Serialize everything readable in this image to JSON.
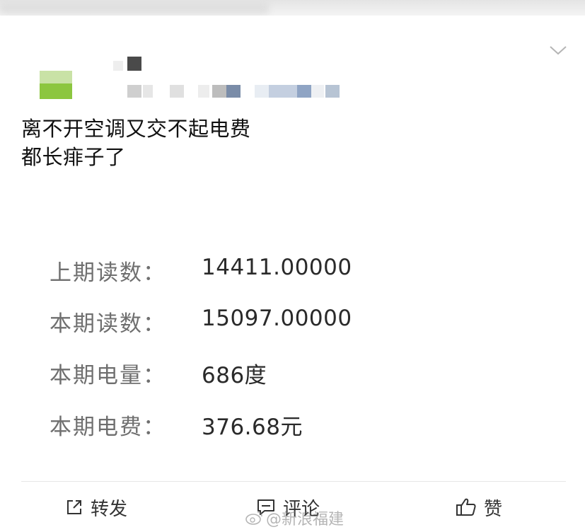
{
  "post": {
    "text_line1": "离不开空调又交不起电费",
    "text_line2": "都长痱子了"
  },
  "bill": {
    "rows": [
      {
        "label": "上期读数：",
        "value": "14411.00000"
      },
      {
        "label": "本期读数：",
        "value": "15097.00000"
      },
      {
        "label": "本期电量：",
        "value": "686度"
      },
      {
        "label": "本期电费：",
        "value": "376.68元"
      }
    ]
  },
  "actions": {
    "repost": "转发",
    "comment": "评论",
    "like": "赞"
  },
  "watermark": {
    "text": "@新浪福建"
  },
  "icons": {
    "more": "chevron-down-icon",
    "repost": "share-icon",
    "comment": "comment-icon",
    "like": "thumbs-up-icon",
    "watermark": "weibo-logo-icon"
  },
  "colors": {
    "avatar_top": "#c9e2a6",
    "avatar_bottom": "#8cc63f",
    "label": "#6f6f6f",
    "value": "#2a2a2a"
  }
}
